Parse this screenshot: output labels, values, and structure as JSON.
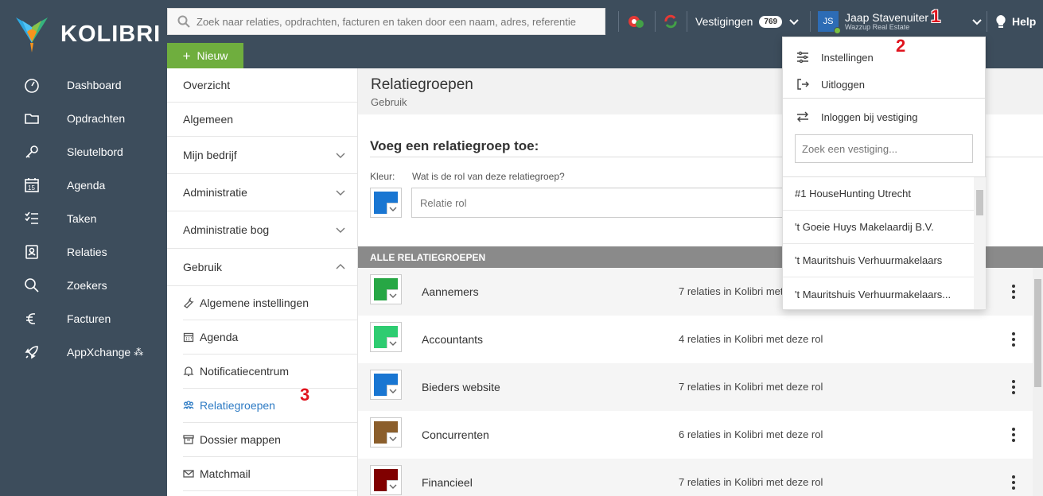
{
  "brand": {
    "name": "KOLIBRI"
  },
  "nav": [
    {
      "label": "Dashboard",
      "icon": "dashboard-icon"
    },
    {
      "label": "Opdrachten",
      "icon": "folder-icon"
    },
    {
      "label": "Sleutelbord",
      "icon": "key-icon"
    },
    {
      "label": "Agenda",
      "icon": "calendar-icon"
    },
    {
      "label": "Taken",
      "icon": "tasks-icon"
    },
    {
      "label": "Relaties",
      "icon": "contacts-icon"
    },
    {
      "label": "Zoekers",
      "icon": "search-icon"
    },
    {
      "label": "Facturen",
      "icon": "euro-icon"
    },
    {
      "label": "AppXchange",
      "icon": "rocket-icon"
    }
  ],
  "calendar_day": "15",
  "search": {
    "placeholder": "Zoek naar relaties, opdrachten, facturen en taken door een naam, adres, referentie"
  },
  "topbar": {
    "vestigingen_label": "Vestigingen",
    "vestigingen_count": "769",
    "user_initials": "JS",
    "user_name": "Jaap Stavenuiter",
    "user_company": "Wazzup Real Estate",
    "help_label": "Help"
  },
  "new_button": "Nieuw",
  "annotations": {
    "one": "1",
    "two": "2",
    "three": "3"
  },
  "menu": {
    "overzicht": "Overzicht",
    "algemeen": "Algemeen",
    "mijn_bedrijf": "Mijn bedrijf",
    "administratie": "Administratie",
    "administratie_bog": "Administratie bog",
    "gebruik": "Gebruik",
    "sub": [
      {
        "label": "Algemene instellingen",
        "icon": "wrench-icon"
      },
      {
        "label": "Agenda",
        "icon": "calendar-icon"
      },
      {
        "label": "Notificatiecentrum",
        "icon": "bell-icon"
      },
      {
        "label": "Relatiegroepen",
        "icon": "group-icon"
      },
      {
        "label": "Dossier mappen",
        "icon": "archive-icon"
      },
      {
        "label": "Matchmail",
        "icon": "mail-icon"
      }
    ]
  },
  "page": {
    "title": "Relatiegroepen",
    "subtitle": "Gebruik"
  },
  "form": {
    "heading": "Voeg een relatiegroep toe:",
    "color_label": "Kleur:",
    "role_label": "Wat is de rol van deze relatiegroep?",
    "role_placeholder": "Relatie rol",
    "default_color": "#1976d2"
  },
  "list": {
    "header": "ALLE RELATIEGROEPEN",
    "rows": [
      {
        "name": "Aannemers",
        "count": "7 relaties in Kolibri met deze rol",
        "color": "#27a745"
      },
      {
        "name": "Accountants",
        "count": "4 relaties in Kolibri met deze rol",
        "color": "#2ecc71"
      },
      {
        "name": "Bieders website",
        "count": "7 relaties in Kolibri met deze rol",
        "color": "#1976d2"
      },
      {
        "name": "Concurrenten",
        "count": "6 relaties in Kolibri met deze rol",
        "color": "#8b5e2b"
      },
      {
        "name": "Financieel",
        "count": "7 relaties in Kolibri met deze rol",
        "color": "#800000"
      }
    ]
  },
  "dropdown": {
    "settings": "Instellingen",
    "logout": "Uitloggen",
    "login_branch": "Inloggen bij vestiging",
    "branch_search_placeholder": "Zoek een vestiging...",
    "branches": [
      "#1 HouseHunting Utrecht",
      "'t Goeie Huys Makelaardij B.V.",
      "'t Mauritshuis Verhuurmakelaars",
      "'t Mauritshuis Verhuurmakelaars..."
    ]
  }
}
